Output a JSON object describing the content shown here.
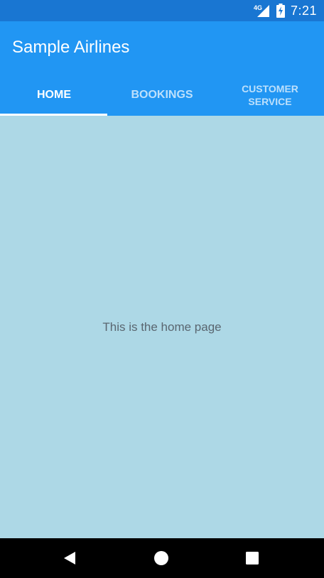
{
  "status_bar": {
    "network_type": "4G",
    "time": "7:21",
    "icons": [
      "signal-icon",
      "battery-icon"
    ]
  },
  "app_bar": {
    "title": "Sample Airlines"
  },
  "tabs": [
    {
      "label": "HOME",
      "active": true
    },
    {
      "label": "BOOKINGS",
      "active": false
    },
    {
      "label": "CUSTOMER SERVICE",
      "active": false
    }
  ],
  "content": {
    "message": "This is the home page"
  },
  "navigation_bar": {
    "buttons": [
      "back-icon",
      "home-icon",
      "recent-apps-icon"
    ]
  },
  "colors": {
    "status_bar": "#1976D2",
    "app_bar": "#2196F3",
    "content_background": "#ADD8E6",
    "navigation_bar": "#000000",
    "tab_indicator": "#FFFFFF",
    "content_text": "#5A6670"
  }
}
